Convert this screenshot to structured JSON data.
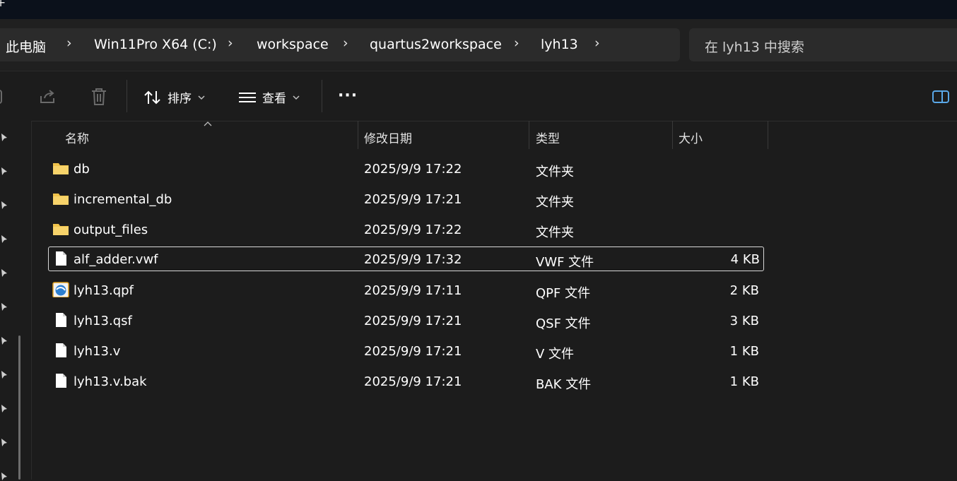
{
  "titlebar": {
    "partial_glyph": "+"
  },
  "breadcrumb": [
    {
      "label": "此电脑"
    },
    {
      "label": "Win11Pro X64 (C:)"
    },
    {
      "label": "workspace"
    },
    {
      "label": "quartus2workspace"
    },
    {
      "label": "lyh13"
    }
  ],
  "breadcrumb_separator": "›",
  "search": {
    "placeholder": "在 lyh13 中搜索"
  },
  "toolbar": {
    "sort_label": "排序",
    "view_label": "查看",
    "more_label": "···"
  },
  "columns": {
    "name": "名称",
    "modified": "修改日期",
    "type": "类型",
    "size": "大小"
  },
  "files": [
    {
      "name": "db",
      "modified": "2025/9/9 17:22",
      "type": "文件夹",
      "size": "",
      "icon": "folder-icon"
    },
    {
      "name": "incremental_db",
      "modified": "2025/9/9 17:21",
      "type": "文件夹",
      "size": "",
      "icon": "folder-icon"
    },
    {
      "name": "output_files",
      "modified": "2025/9/9 17:22",
      "type": "文件夹",
      "size": "",
      "icon": "folder-icon"
    },
    {
      "name": "alf_adder.vwf",
      "modified": "2025/9/9 17:32",
      "type": "VWF 文件",
      "size": "4 KB",
      "icon": "file-icon",
      "selected": true
    },
    {
      "name": "lyh13.qpf",
      "modified": "2025/9/9 17:11",
      "type": "QPF 文件",
      "size": "2 KB",
      "icon": "quartus-project-icon"
    },
    {
      "name": "lyh13.qsf",
      "modified": "2025/9/9 17:21",
      "type": "QSF 文件",
      "size": "3 KB",
      "icon": "file-icon"
    },
    {
      "name": "lyh13.v",
      "modified": "2025/9/9 17:21",
      "type": "V 文件",
      "size": "1 KB",
      "icon": "file-icon"
    },
    {
      "name": "lyh13.v.bak",
      "modified": "2025/9/9 17:21",
      "type": "BAK 文件",
      "size": "1 KB",
      "icon": "file-icon"
    }
  ],
  "colors": {
    "background": "#1c1c1c",
    "bar": "#2b2b2b",
    "folder": "#f0c24a",
    "selection_border": "#d8d8d8"
  }
}
